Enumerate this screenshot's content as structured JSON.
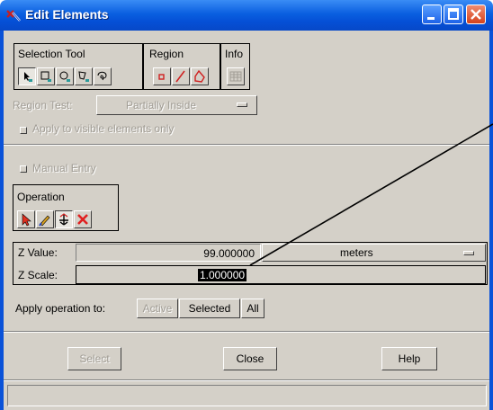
{
  "window": {
    "title": "Edit Elements"
  },
  "selection_tool": {
    "label": "Selection Tool",
    "icons": [
      "pointer-select-icon",
      "rectangle-select-icon",
      "circle-select-icon",
      "polygon-select-icon",
      "lasso-select-icon"
    ]
  },
  "region": {
    "label": "Region",
    "icons": [
      "point-region-icon",
      "line-region-icon",
      "polygon-region-icon"
    ]
  },
  "info": {
    "label": "Info"
  },
  "region_test": {
    "label": "Region Test:",
    "value": "Partially Inside"
  },
  "apply_visible": {
    "label": "Apply to visible elements only"
  },
  "manual_entry": {
    "label": "Manual Entry"
  },
  "operation": {
    "label": "Operation",
    "icons": [
      "select-arrow-icon",
      "pencil-edit-icon",
      "z-axis-icon",
      "delete-x-icon"
    ]
  },
  "z_value": {
    "label": "Z Value:",
    "value": "99.000000",
    "units": "meters"
  },
  "z_scale": {
    "label": "Z Scale:",
    "value": "1.000000"
  },
  "apply_to": {
    "label": "Apply operation to:",
    "active": "Active",
    "selected": "Selected",
    "all": "All"
  },
  "buttons": {
    "select": "Select",
    "close": "Close",
    "help": "Help"
  },
  "colors": {
    "title_blue": "#0a5fe0",
    "dialog_gray": "#d4d0c8",
    "close_red": "#d4421c"
  }
}
